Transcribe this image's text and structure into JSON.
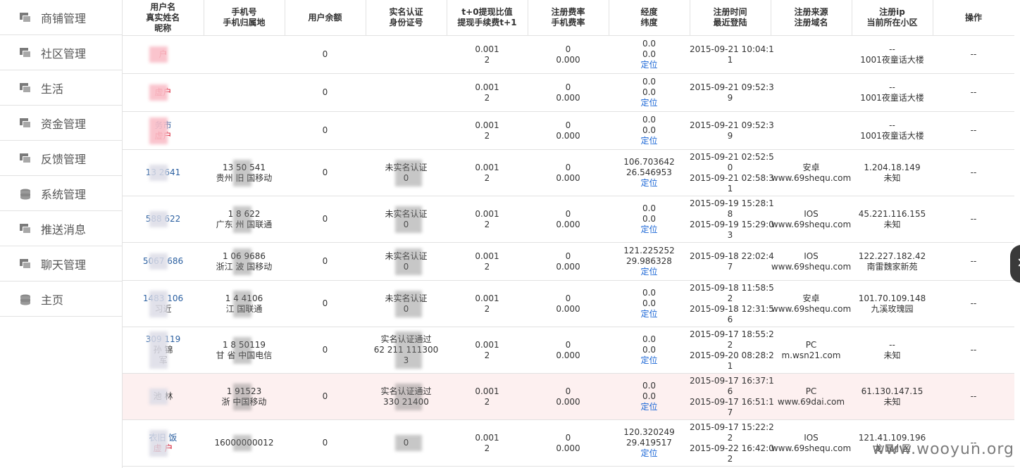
{
  "sidebar": {
    "items": [
      {
        "label": "商铺管理",
        "icon": "window-icon"
      },
      {
        "label": "社区管理",
        "icon": "window-icon"
      },
      {
        "label": "生活",
        "icon": "window-icon"
      },
      {
        "label": "资金管理",
        "icon": "window-icon"
      },
      {
        "label": "反馈管理",
        "icon": "window-icon"
      },
      {
        "label": "系统管理",
        "icon": "database-icon"
      },
      {
        "label": "推送消息",
        "icon": "window-icon"
      },
      {
        "label": "聊天管理",
        "icon": "window-icon"
      },
      {
        "label": "主页",
        "icon": "database-icon"
      }
    ]
  },
  "table": {
    "headers": [
      [
        "用户名",
        "真实姓名",
        "昵称"
      ],
      [
        "手机号",
        "手机归属地"
      ],
      [
        "用户余额"
      ],
      [
        "实名认证",
        "身份证号"
      ],
      [
        "t+0提现比值",
        "提现手续费t+1"
      ],
      [
        "注册费率",
        "手机费率"
      ],
      [
        "经度",
        "纬度"
      ],
      [
        "注册时间",
        "最近登陆"
      ],
      [
        "注册来源",
        "注册域名"
      ],
      [
        "注册ip",
        "当前所在小区"
      ],
      [
        "操作"
      ]
    ],
    "rows": [
      {
        "user": [
          "",
          "户"
        ],
        "phone": [],
        "balance": "0",
        "auth": [],
        "t0": [
          "0.001",
          "2"
        ],
        "rate": [
          "0",
          "0.000"
        ],
        "geo": [
          "0.0",
          "0.0",
          "定位"
        ],
        "time": [
          "2015-09-21 10:04:1",
          "1"
        ],
        "source": [],
        "ip": [
          "--",
          "1001夜童话大楼"
        ],
        "op": "--"
      },
      {
        "user": [
          "",
          "虚户"
        ],
        "phone": [],
        "balance": "0",
        "auth": [],
        "t0": [
          "0.001",
          "2"
        ],
        "rate": [
          "0",
          "0.000"
        ],
        "geo": [
          "0.0",
          "0.0",
          "定位"
        ],
        "time": [
          "2015-09-21 09:52:3",
          "9"
        ],
        "source": [],
        "ip": [
          "--",
          "1001夜童话大楼"
        ],
        "op": "--"
      },
      {
        "user": [
          "务市",
          "虚户"
        ],
        "phone": [],
        "balance": "0",
        "auth": [],
        "t0": [
          "0.001",
          "2"
        ],
        "rate": [
          "0",
          "0.000"
        ],
        "geo": [
          "0.0",
          "0.0",
          "定位"
        ],
        "time": [
          "2015-09-21 09:52:3",
          "9"
        ],
        "source": [],
        "ip": [
          "--",
          "1001夜童话大楼"
        ],
        "op": "--"
      },
      {
        "user": [
          "13    2641"
        ],
        "phone": [
          "13    50    541",
          "贵州    旧    国移动"
        ],
        "balance": "0",
        "auth": [
          "未实名认证",
          "0"
        ],
        "t0": [
          "0.001",
          "2"
        ],
        "rate": [
          "0",
          "0.000"
        ],
        "geo": [
          "106.703642",
          "26.546953",
          "定位"
        ],
        "time": [
          "2015-09-21 02:52:5",
          "0",
          "2015-09-21 02:58:3",
          "1"
        ],
        "source": [
          "安卓",
          "www.69shequ.com"
        ],
        "ip": [
          "1.204.18.149",
          "未知"
        ],
        "op": "--"
      },
      {
        "user": [
          "588    622"
        ],
        "phone": [
          "1    8    622",
          "广东    州    国联通"
        ],
        "balance": "0",
        "auth": [
          "未实名认证",
          "0"
        ],
        "t0": [
          "0.001",
          "2"
        ],
        "rate": [
          "0",
          "0.000"
        ],
        "geo": [
          "0.0",
          "0.0",
          "定位"
        ],
        "time": [
          "2015-09-19 15:28:1",
          "8",
          "2015-09-19 15:29:0",
          "3"
        ],
        "source": [
          "IOS",
          "www.69shequ.com"
        ],
        "ip": [
          "45.221.116.155",
          "未知"
        ],
        "op": "--"
      },
      {
        "user": [
          "5067    686"
        ],
        "phone": [
          "1    06    9686",
          "浙江    波    国移动"
        ],
        "balance": "0",
        "auth": [
          "未实名认证",
          "0"
        ],
        "t0": [
          "0.001",
          "2"
        ],
        "rate": [
          "0",
          "0.000"
        ],
        "geo": [
          "121.225252",
          "29.986328",
          "定位"
        ],
        "time": [
          "2015-09-18 22:02:4",
          "7"
        ],
        "source": [
          "IOS",
          "www.69shequ.com"
        ],
        "ip": [
          "122.227.182.42",
          "南雷魏家新苑"
        ],
        "op": "--"
      },
      {
        "user": [
          "1483    106",
          "",
          "习近"
        ],
        "phone": [
          "1    4    4106",
          "    江    国联通"
        ],
        "balance": "0",
        "auth": [
          "未实名认证",
          "0"
        ],
        "t0": [
          "0.001",
          "2"
        ],
        "rate": [
          "0",
          "0.000"
        ],
        "geo": [
          "0.0",
          "0.0",
          "定位"
        ],
        "time": [
          "2015-09-18 11:58:5",
          "2",
          "2015-09-18 12:31:5",
          "6"
        ],
        "source": [
          "安卓",
          "www.69shequ.com"
        ],
        "ip": [
          "101.70.109.148",
          "九溪玫瑰园"
        ],
        "op": "--"
      },
      {
        "user": [
          "309    119",
          "孙    锦",
          "    军"
        ],
        "phone": [
          "1    8    50119",
          "甘    省    中国电信"
        ],
        "balance": "0",
        "auth": [
          "实名认证通过",
          "62    211    111300",
          "    3"
        ],
        "t0": [
          "0.001",
          "2"
        ],
        "rate": [
          "0",
          "0.000"
        ],
        "geo": [
          "0.0",
          "0.0",
          "定位"
        ],
        "time": [
          "2015-09-17 18:55:2",
          "2",
          "2015-09-20 08:28:2",
          "1"
        ],
        "source": [
          "PC",
          "m.wsn21.com"
        ],
        "ip": [
          "--",
          "未知"
        ],
        "op": "--"
      },
      {
        "user": [
          "    ",
          "池    林",
          "    "
        ],
        "phone": [
          "1    91523",
          "浙    中国移动"
        ],
        "balance": "0",
        "auth": [
          "实名认证通过",
          "330    21400"
        ],
        "t0": [
          "0.001",
          "2"
        ],
        "rate": [
          "0",
          "0.000"
        ],
        "geo": [
          "0.0",
          "0.0",
          "定位"
        ],
        "time": [
          "2015-09-17 16:37:1",
          "6",
          "2015-09-17 16:51:1",
          "7"
        ],
        "source": [
          "PC",
          "www.69dai.com"
        ],
        "ip": [
          "61.130.147.15",
          "未知"
        ],
        "op": "--",
        "highlight": true
      },
      {
        "user": [
          "衣旧    饭",
          "虚    户"
        ],
        "phone": [
          "16000000012"
        ],
        "balance": "0",
        "auth": [
          "",
          "0"
        ],
        "t0": [
          "0.001",
          "2"
        ],
        "rate": [
          "0",
          "0.000"
        ],
        "geo": [
          "120.320249",
          "29.419517",
          "定位"
        ],
        "time": [
          "2015-09-17 15:22:2",
          "2",
          "2015-09-22 16:42:0",
          "2"
        ],
        "source": [
          "IOS",
          "www.69shequ.com"
        ],
        "ip": [
          "121.41.109.196",
          "龙    园小区"
        ],
        "op": "--"
      }
    ]
  },
  "watermark": "www.wooyun.org"
}
